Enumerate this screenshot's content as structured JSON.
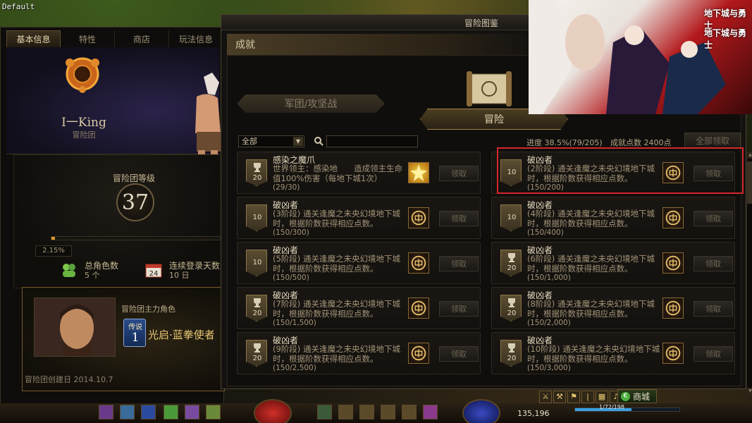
{
  "window_tag": "Default",
  "left_panel": {
    "tabs": [
      "基本信息",
      "特性",
      "商店",
      "玩法信息"
    ],
    "guild_name": "I一King",
    "guild_sub": "冒险团",
    "level_label": "冒险团等级",
    "level": "37",
    "exp_percent_text": "2.15%",
    "exp_fraction": 0.0215,
    "characters_label": "总角色数",
    "characters_value": "5 个",
    "login_label": "连续登录天数",
    "login_value": "10 日",
    "calendar_day": "24",
    "main_role_label": "冒险团主力角色",
    "legend_badge": "传说",
    "legend_number": "1",
    "main_role_name": "光启·蓝拳使者",
    "created": "冒险团创建日 2014.10.7"
  },
  "book": {
    "title": "冒险图鉴",
    "section": "成就",
    "tab_legion": "军团/攻坚战",
    "tab_adventure": "冒险",
    "filter": "全部",
    "search_placeholder": "",
    "progress": "进度 38.5%(79/205)",
    "points": "成就点数 2400点",
    "claim_all": "全部领取"
  },
  "achievements": [
    {
      "title": "感染之魔爪",
      "desc": "世界领主：感染地　　造成领主生命值100%伤害（每地下城1次）",
      "progress": "(29/30)",
      "points": "20",
      "trophy": true,
      "reward": "gold",
      "claim": "领取"
    },
    {
      "title": "破凶者",
      "desc": "(2阶段) 通关逢魔之未央幻境地下城时，根据阶数获得相应点数。",
      "progress": "(150/200)",
      "points": "10",
      "trophy": false,
      "reward": "emblem",
      "claim": "领取"
    },
    {
      "title": "破凶者",
      "desc": "(3阶段) 通关逢魔之未央幻境地下城时，根据阶数获得相应点数。",
      "progress": "(150/300)",
      "points": "10",
      "trophy": false,
      "reward": "emblem",
      "claim": "领取"
    },
    {
      "title": "破凶者",
      "desc": "(4阶段) 通关逢魔之未央幻境地下城时，根据阶数获得相应点数。",
      "progress": "(150/400)",
      "points": "10",
      "trophy": false,
      "reward": "emblem",
      "claim": "领取"
    },
    {
      "title": "破凶者",
      "desc": "(5阶段) 通关逢魔之未央幻境地下城时，根据阶数获得相应点数。",
      "progress": "(150/500)",
      "points": "10",
      "trophy": false,
      "reward": "emblem",
      "claim": "领取"
    },
    {
      "title": "破凶者",
      "desc": "(6阶段) 通关逢魔之未央幻境地下城时，根据阶数获得相应点数。",
      "progress": "(150/1,000)",
      "points": "20",
      "trophy": true,
      "reward": "emblem",
      "claim": "领取"
    },
    {
      "title": "破凶者",
      "desc": "(7阶段) 通关逢魔之未央幻境地下城时，根据阶数获得相应点数。",
      "progress": "(150/1,500)",
      "points": "20",
      "trophy": true,
      "reward": "emblem",
      "claim": "领取"
    },
    {
      "title": "破凶者",
      "desc": "(8阶段) 通关逢魔之未央幻境地下城时，根据阶数获得相应点数。",
      "progress": "(150/2,000)",
      "points": "20",
      "trophy": true,
      "reward": "emblem",
      "claim": "领取"
    },
    {
      "title": "破凶者",
      "desc": "(9阶段) 通关逢魔之未央幻境地下城时，根据阶数获得相应点数。",
      "progress": "(150/2,500)",
      "points": "20",
      "trophy": true,
      "reward": "emblem",
      "claim": "领取"
    },
    {
      "title": "破凶者",
      "desc": "(10阶段) 通关逢魔之未央幻境地下城时，根据阶数获得相应点数。",
      "progress": "(150/3,000)",
      "points": "20",
      "trophy": true,
      "reward": "emblem",
      "claim": "领取"
    }
  ],
  "hud": {
    "gold": "135,196",
    "xp_text": "1/72/198",
    "shop": "商城"
  },
  "promo": {
    "logo_top": "地下城与勇士",
    "logo_bottom": "地下城与勇士"
  }
}
